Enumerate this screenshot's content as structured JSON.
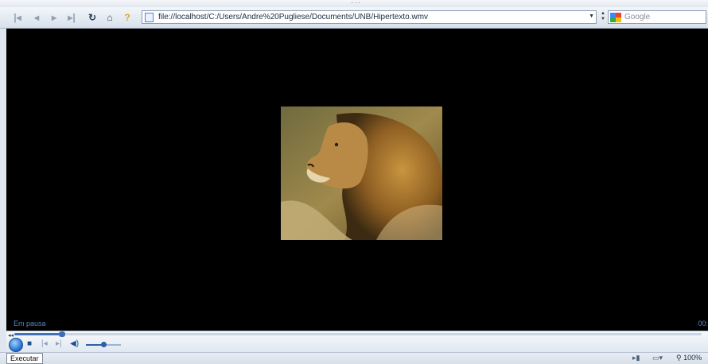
{
  "toolbar": {
    "url": "file://localhost/C:/Users/Andre%20Pugliese/Documents/UNB/Hipertexto.wmv",
    "search_placeholder": "Google"
  },
  "player": {
    "status": "Em pausa",
    "timecode": "00:",
    "seek_progress": 0.07,
    "volume": 0.5,
    "play_tooltip": "Executar"
  },
  "statusbar": {
    "zoom": "100%"
  },
  "icons": [
    "first-page-icon",
    "back-arrow-icon",
    "forward-arrow-icon",
    "last-page-icon",
    "reload-icon",
    "home-icon",
    "help-icon",
    "page-icon",
    "google-icon",
    "play-icon",
    "stop-icon",
    "previous-track-icon",
    "next-track-icon",
    "speaker-icon",
    "zoom-icon"
  ]
}
